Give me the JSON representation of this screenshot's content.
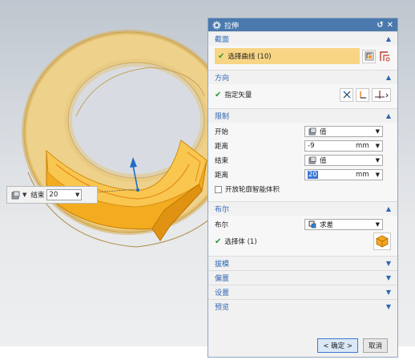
{
  "dialog": {
    "title": "拉伸",
    "sections": {
      "section_curve": {
        "title": "截面",
        "select_curve": "选择曲线 (10)"
      },
      "direction": {
        "title": "方向",
        "specify_vector": "指定矢量"
      },
      "limits": {
        "title": "限制",
        "start_label": "开始",
        "start_value": "值",
        "distance_label": "距离",
        "start_distance": "-9",
        "end_label": "结束",
        "end_value": "值",
        "end_distance": "20",
        "unit": "mm",
        "open_profile": "开放轮廓智能体积"
      },
      "boolean": {
        "title": "布尔",
        "boolean_label": "布尔",
        "boolean_value": "求差",
        "select_body": "选择体 (1)"
      },
      "draft": {
        "title": "拔模"
      },
      "offset": {
        "title": "偏置"
      },
      "settings": {
        "title": "设置"
      },
      "preview": {
        "title": "预览"
      }
    },
    "ok_button": "< 确定 >",
    "cancel_button": "取消"
  },
  "floating": {
    "label": "结束",
    "value": "20"
  },
  "icons": [
    "gear-icon",
    "reset-icon",
    "close-icon",
    "chevron-up-icon",
    "chevron-down-icon",
    "checkmark-icon",
    "curve-rule-icon",
    "sketch-section-icon",
    "vector-icon",
    "reverse-direction-icon",
    "axis-icon",
    "value-icon",
    "dropdown-icon",
    "subtract-icon",
    "solid-body-icon"
  ],
  "colors": {
    "title_bar": "#4a79ad",
    "section_heading": "#2f66b3",
    "selection_highlight": "#f8d584",
    "model": "#f5b833",
    "check": "#2a9b36"
  }
}
